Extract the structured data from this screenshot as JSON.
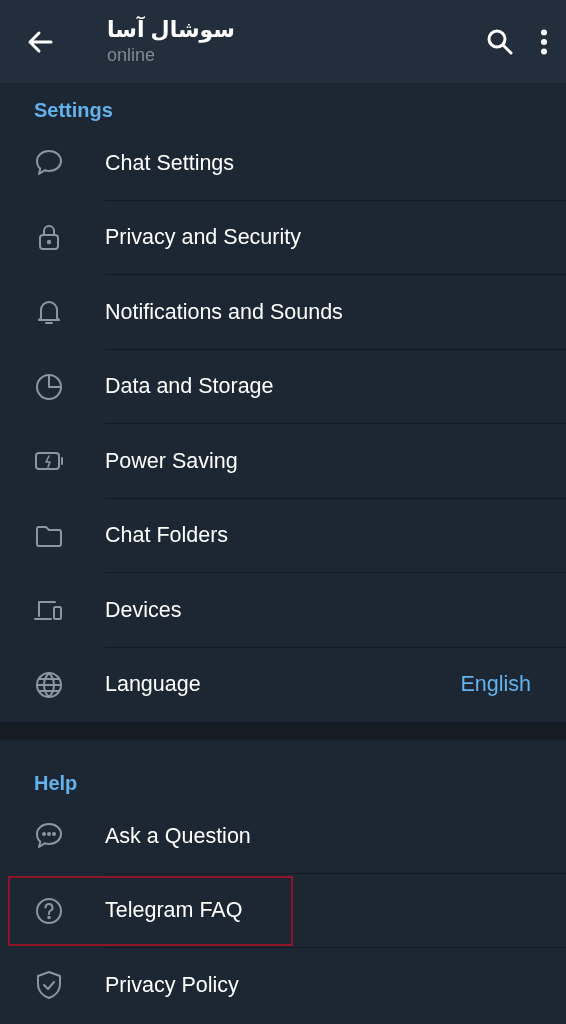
{
  "header": {
    "title": "سوشال آسا",
    "status": "online"
  },
  "sections": [
    {
      "title": "Settings",
      "rows": [
        {
          "label": "Chat Settings",
          "highlighted": false
        },
        {
          "label": "Privacy and Security",
          "highlighted": false
        },
        {
          "label": "Notifications and Sounds",
          "highlighted": false
        },
        {
          "label": "Data and Storage",
          "highlighted": false
        },
        {
          "label": "Power Saving",
          "highlighted": false
        },
        {
          "label": "Chat Folders",
          "highlighted": false
        },
        {
          "label": "Devices",
          "highlighted": false
        },
        {
          "label": "Language",
          "value": "English",
          "highlighted": false
        }
      ]
    },
    {
      "title": "Help",
      "rows": [
        {
          "label": "Ask a Question",
          "highlighted": false
        },
        {
          "label": "Telegram FAQ",
          "highlighted": true
        },
        {
          "label": "Privacy Policy",
          "highlighted": false
        }
      ]
    }
  ]
}
